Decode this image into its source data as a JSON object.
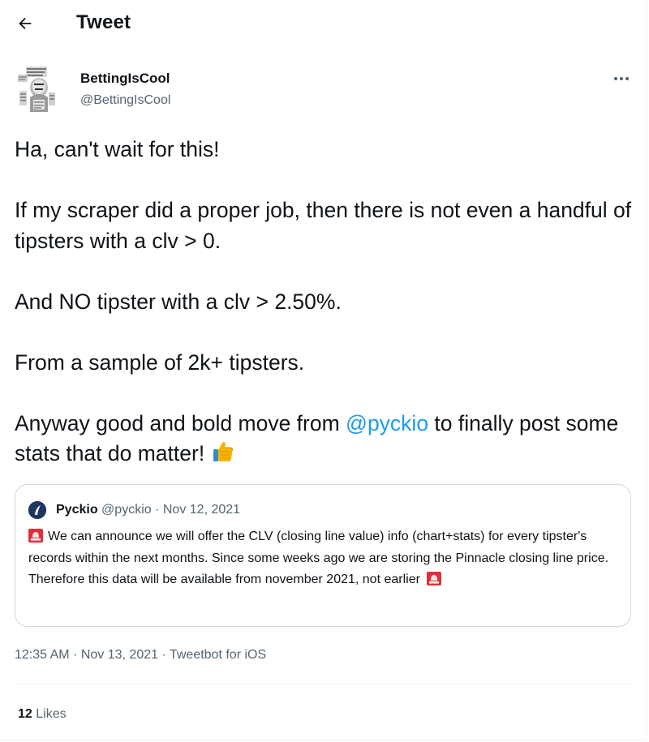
{
  "header": {
    "title": "Tweet",
    "back_icon": "arrow-left-icon"
  },
  "author": {
    "name": "BettingIsCool",
    "handle": "@BettingIsCool",
    "more_icon": "more-horizontal-icon"
  },
  "tweet": {
    "paragraphs": [
      "Ha, can't wait for this!",
      "If my scraper did a proper job, then there is not even a handful of tipsters with a clv > 0.",
      "And NO tipster with a clv > 2.50%.",
      "From a sample of 2k+ tipsters."
    ],
    "last_paragraph": {
      "before": "Anyway good and bold move from ",
      "mention": "@pyckio",
      "after": " to finally post some stats that do matter!",
      "emoji": "thumbs-up-icon"
    }
  },
  "quote": {
    "name": "Pyckio",
    "handle": "@pyckio",
    "separator": "·",
    "date": "Nov 12, 2021",
    "text": "We can announce we will offer the CLV (closing line value) info (chart+stats) for every tipster's records within the next months. Since some weeks ago we are storing the Pinnacle closing line price. Therefore this data will be available from november 2021, not earlier",
    "emoji": "rotating-light-icon"
  },
  "meta": {
    "time": "12:35 AM",
    "separator": "·",
    "date": "Nov 13, 2021",
    "source": "Tweetbot for iOS"
  },
  "stats": {
    "likes_count": "12",
    "likes_label": "Likes"
  },
  "colors": {
    "link": "#1d9bf0",
    "secondary_text": "#536471",
    "border": "#cfd9de",
    "divider": "#eff3f4",
    "siren_red": "#e0303a"
  }
}
